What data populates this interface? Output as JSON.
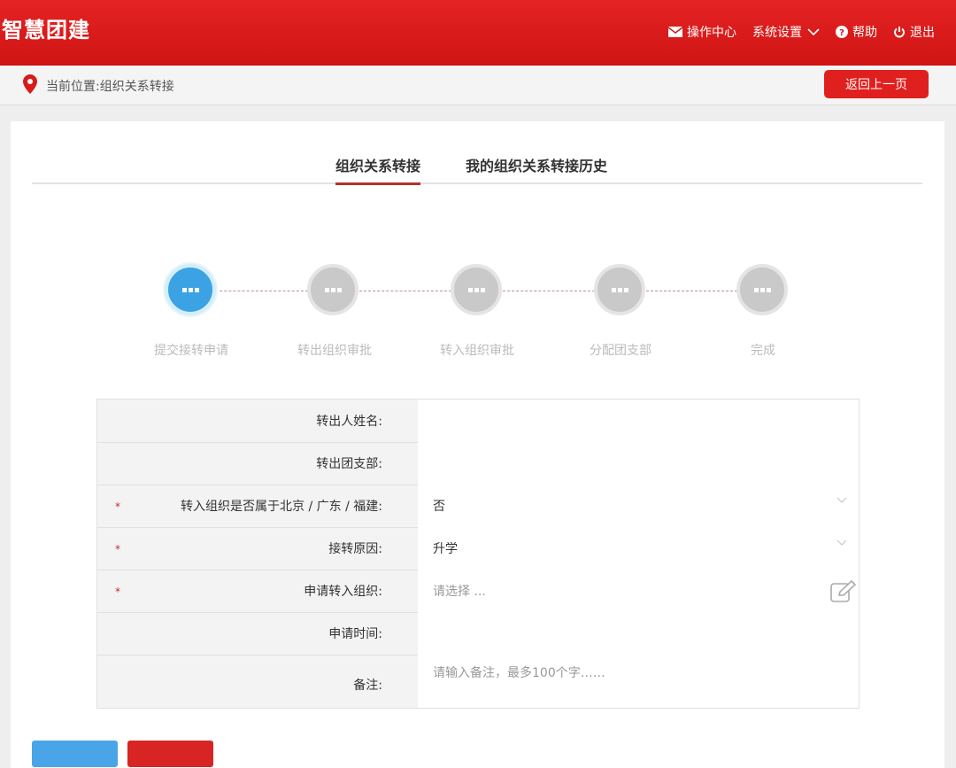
{
  "header": {
    "brand": "智慧团建",
    "nav": [
      {
        "label": "操作中心",
        "icon": "envelope-icon"
      },
      {
        "label": "系统设置",
        "icon": "chevron-down-icon"
      },
      {
        "label": "帮助",
        "icon": "help-icon"
      },
      {
        "label": "退出",
        "icon": "power-icon"
      }
    ]
  },
  "breadcrumb": {
    "text": "当前位置:组织关系转接",
    "back_label": "返回上一页"
  },
  "tabs": [
    {
      "label": "组织关系转接",
      "active": true
    },
    {
      "label": "我的组织关系转接历史",
      "active": false
    }
  ],
  "steps": [
    {
      "label": "提交接转申请",
      "active": true
    },
    {
      "label": "转出组织审批",
      "active": false
    },
    {
      "label": "转入组织审批",
      "active": false
    },
    {
      "label": "分配团支部",
      "active": false
    },
    {
      "label": "完成",
      "active": false
    }
  ],
  "form": {
    "rows": [
      {
        "label": "转出人姓名:",
        "required": false,
        "value": ""
      },
      {
        "label": "转出团支部:",
        "required": false,
        "value": ""
      },
      {
        "label": "转入组织是否属于北京 / 广东 / 福建:",
        "required": true,
        "value": "否"
      },
      {
        "label": "接转原因:",
        "required": true,
        "value": "升学"
      },
      {
        "label": "申请转入组织:",
        "required": true,
        "placeholder": "请选择 ..."
      },
      {
        "label": "申请时间:",
        "required": false,
        "value": ""
      },
      {
        "label": "备注:",
        "required": false,
        "placeholder": "请输入备注，最多100个字……"
      }
    ],
    "required_mark": "*"
  },
  "colors": {
    "brand_red": "#e01e1e",
    "step_active": "#3ba3e3",
    "step_inactive": "#c9c9c9"
  }
}
